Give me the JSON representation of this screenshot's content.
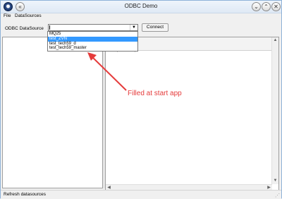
{
  "window": {
    "title": "ODBC Demo",
    "buttons": {
      "minimize": "⌄",
      "restore": "⌃",
      "close": "✕"
    }
  },
  "menu": {
    "items": [
      "File",
      "DataSources"
    ]
  },
  "toolbar": {
    "datasource_label": "ODBC DataSource",
    "combo_value": "",
    "connect_label": "Connect"
  },
  "dropdown": {
    "options": [
      "MQ25",
      "test_ZVN",
      "test_tech59_d",
      "test_tech59_master"
    ],
    "selected_index": 1
  },
  "annotation": {
    "text": "Filled at start app",
    "color": "#e53b3b"
  },
  "status": {
    "text": "Refresh datasources"
  },
  "colors": {
    "selection": "#3399ff",
    "titlebar": "#dfe9f5"
  },
  "icons": {
    "scroll_up": "▲",
    "scroll_down": "▼",
    "scroll_left": "◀",
    "scroll_right": "▶",
    "combo_arrow": "▼",
    "grip": "⋰"
  }
}
